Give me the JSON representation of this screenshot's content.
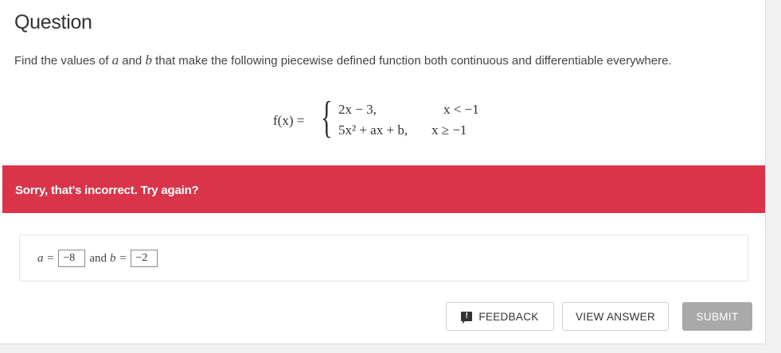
{
  "question": {
    "title": "Question",
    "prompt_part1": "Find the values of ",
    "var_a": "a",
    "prompt_part2": " and ",
    "var_b": "b",
    "prompt_part3": " that make the following piecewise defined function both continuous and differentiable everywhere."
  },
  "equation": {
    "lhs": "f(x) =",
    "case1_expr": "2x − 3,",
    "case1_cond": "x < −1",
    "case2_expr": "5x² + ax + b,",
    "case2_cond": "x ≥ −1"
  },
  "feedback": {
    "message": "Sorry, that's incorrect. Try again?",
    "color": "#d93449"
  },
  "answer": {
    "a_label": "a =",
    "a_value": "−8",
    "conjunction": "and",
    "b_label": "b =",
    "b_value": "−2"
  },
  "buttons": {
    "feedback_icon": "exclamation-speech-icon",
    "feedback_label": "FEEDBACK",
    "view_answer_label": "VIEW ANSWER",
    "submit_label": "SUBMIT"
  }
}
